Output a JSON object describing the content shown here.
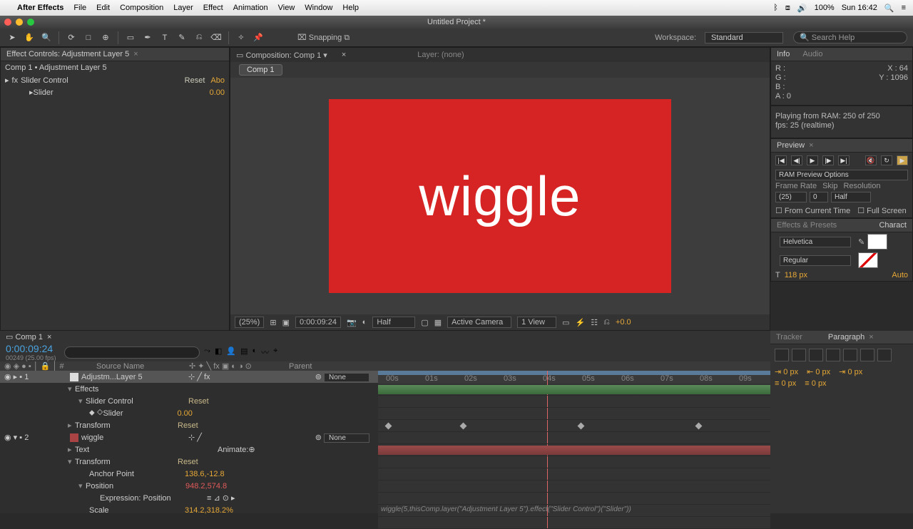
{
  "mac": {
    "app": "After Effects",
    "menus": [
      "File",
      "Edit",
      "Composition",
      "Layer",
      "Effect",
      "Animation",
      "View",
      "Window",
      "Help"
    ],
    "battery": "100%",
    "clock": "Sun 16:42"
  },
  "window_title": "Untitled Project *",
  "toolbar": {
    "snapping": "Snapping",
    "workspace_label": "Workspace:",
    "workspace_value": "Standard",
    "search_placeholder": "Search Help"
  },
  "effect_controls": {
    "tab": "Effect Controls: Adjustment Layer 5",
    "breadcrumb": "Comp 1 • Adjustment Layer 5",
    "effect_name": "Slider Control",
    "reset": "Reset",
    "about": "Abo",
    "param_name": "Slider",
    "param_value": "0.00"
  },
  "composition": {
    "tab": "Composition: Comp 1",
    "layer_tab": "Layer: (none)",
    "pill": "Comp 1",
    "text": "wiggle",
    "footer": {
      "mag": "(25%)",
      "time": "0:00:09:24",
      "res": "Half",
      "camera": "Active Camera",
      "views": "1 View",
      "exp": "+0.0"
    }
  },
  "info": {
    "tab_info": "Info",
    "tab_audio": "Audio",
    "r": "R :",
    "g": "G :",
    "b": "B :",
    "a": "A : 0",
    "x": "X : 64",
    "y": "Y : 1096",
    "line1": "Playing from RAM: 250 of 250",
    "line2": "fps: 25 (realtime)"
  },
  "preview": {
    "tab": "Preview",
    "options": "RAM Preview Options",
    "frame_rate_lbl": "Frame Rate",
    "skip_lbl": "Skip",
    "res_lbl": "Resolution",
    "frame_rate": "(25)",
    "skip": "0",
    "res": "Half",
    "from_current": "From Current Time",
    "full": "Full Screen"
  },
  "effects_presets": {
    "tab": "Effects & Presets",
    "char_tab": "Charact"
  },
  "character": {
    "font": "Helvetica",
    "weight": "Regular",
    "size": "118 px",
    "auto": "Auto"
  },
  "timeline": {
    "tab": "Comp 1",
    "timecode": "0:00:09:24",
    "sub": "00249 (25.00 fps)",
    "search_placeholder": "",
    "col_source": "Source Name",
    "col_parent": "Parent",
    "ruler": [
      "00s",
      "01s",
      "02s",
      "03s",
      "04s",
      "05s",
      "06s",
      "07s",
      "08s",
      "09s"
    ],
    "layers": {
      "l1_name": "Adjustm...Layer 5",
      "l1_parent": "None",
      "effects": "Effects",
      "slider_ctrl": "Slider Control",
      "reset": "Reset",
      "slider": "Slider",
      "slider_val": "0.00",
      "transform": "Transform",
      "l2_num": "2",
      "l2_name": "wiggle",
      "l2_parent": "None",
      "text": "Text",
      "animate": "Animate:",
      "anchor": "Anchor Point",
      "anchor_val": "138.6,-12.8",
      "position": "Position",
      "position_val": "948.2,574.8",
      "expr_label": "Expression: Position",
      "expr_text": "wiggle(5,thisComp.layer(\"Adjustment Layer 5\").effect(\"Slider Control\")(\"Slider\"))",
      "scale": "Scale",
      "scale_val": "314.2,318.2%"
    }
  },
  "tracker": {
    "tab": "Tracker"
  },
  "paragraph": {
    "tab": "Paragraph",
    "px": "0 px"
  }
}
